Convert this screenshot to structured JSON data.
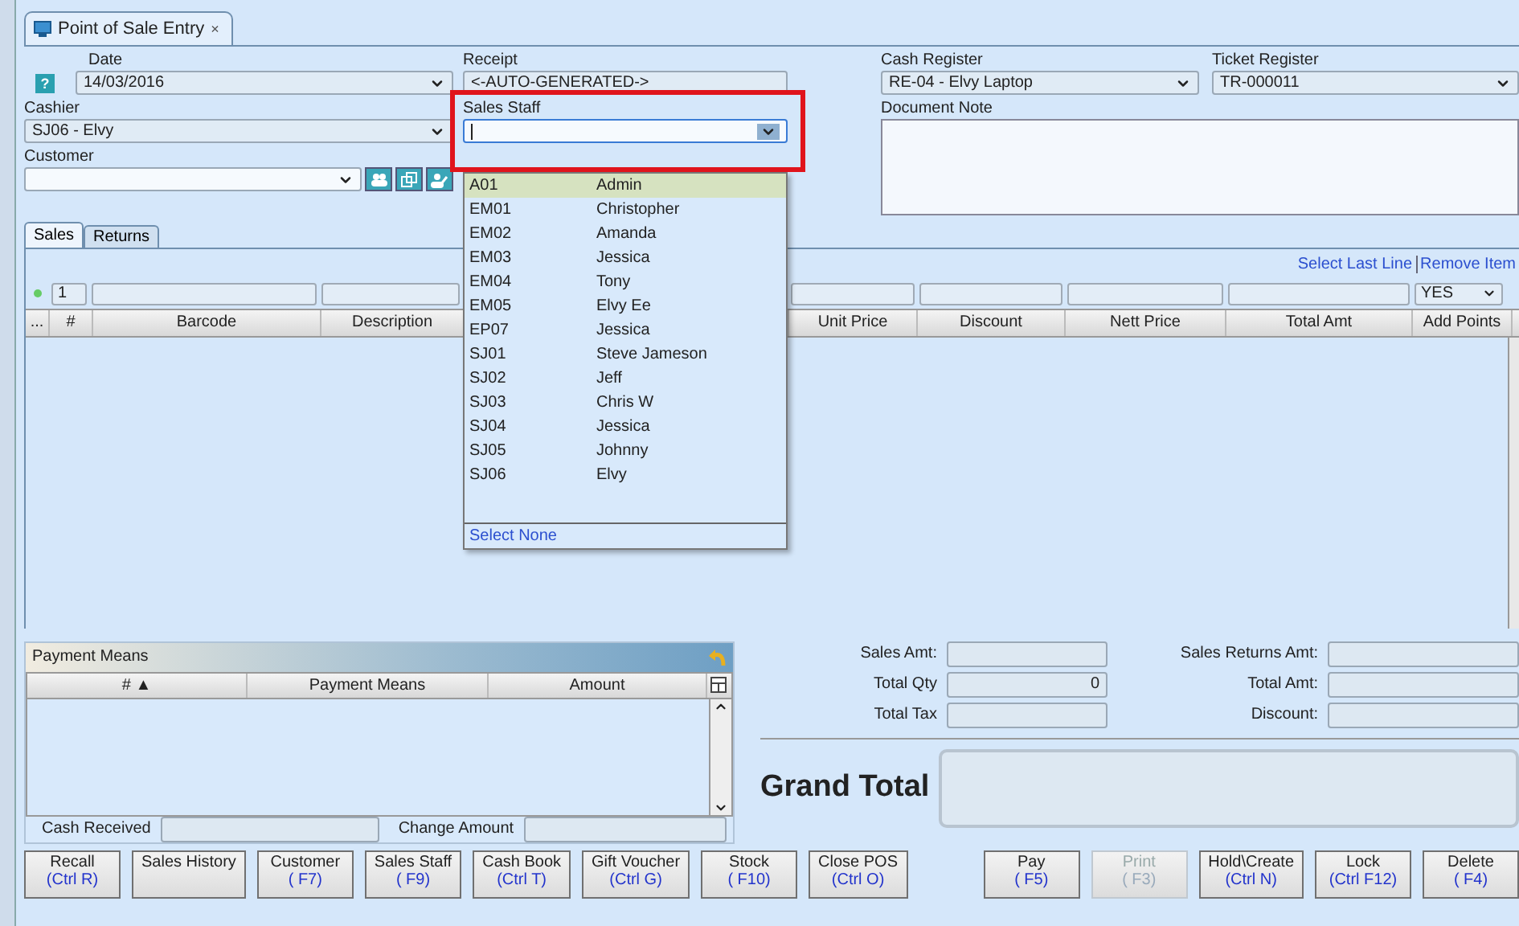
{
  "tab": {
    "label": "Point of Sale Entry",
    "close": "×"
  },
  "form": {
    "help": "?",
    "date": {
      "label": "Date",
      "value": "14/03/2016"
    },
    "receipt": {
      "label": "Receipt",
      "value": "<-AUTO-GENERATED->"
    },
    "cash_register": {
      "label": "Cash Register",
      "value": "RE-04 - Elvy Laptop"
    },
    "ticket_register": {
      "label": "Ticket Register",
      "value": "TR-000011"
    },
    "cashier": {
      "label": "Cashier",
      "value": "SJ06 - Elvy"
    },
    "sales_staff": {
      "label": "Sales Staff",
      "expanded": true
    },
    "document_note": {
      "label": "Document Note"
    },
    "customer": {
      "label": "Customer"
    }
  },
  "sales_staff_dropdown": {
    "items": [
      {
        "code": "A01",
        "name": "Admin",
        "selected": true
      },
      {
        "code": "EM01",
        "name": "Christopher",
        "selected": false
      },
      {
        "code": "EM02",
        "name": "Amanda",
        "selected": false
      },
      {
        "code": "EM03",
        "name": "Jessica",
        "selected": false
      },
      {
        "code": "EM04",
        "name": "Tony",
        "selected": false
      },
      {
        "code": "EM05",
        "name": "Elvy Ee",
        "selected": false
      },
      {
        "code": "EP07",
        "name": "Jessica",
        "selected": false
      },
      {
        "code": "SJ01",
        "name": "Steve Jameson",
        "selected": false
      },
      {
        "code": "SJ02",
        "name": "Jeff",
        "selected": false
      },
      {
        "code": "SJ03",
        "name": "Chris W",
        "selected": false
      },
      {
        "code": "SJ04",
        "name": "Jessica",
        "selected": false
      },
      {
        "code": "SJ05",
        "name": "Johnny",
        "selected": false
      },
      {
        "code": "SJ06",
        "name": "Elvy",
        "selected": false
      }
    ],
    "footer": "Select None"
  },
  "subtabs": [
    {
      "label": "Sales",
      "selected": true
    },
    {
      "label": "Returns",
      "selected": false
    }
  ],
  "grid_links": [
    "Select Last Line",
    "Remove Item"
  ],
  "filter_row": {
    "row_number": "1",
    "add_points": "YES"
  },
  "grid_columns": [
    "...",
    "#",
    "Barcode",
    "Description",
    "Unit Price",
    "Discount",
    "Nett Price",
    "Total Amt",
    "Add Points"
  ],
  "payment_means": {
    "title": "Payment Means",
    "columns": [
      "# ▲",
      "Payment Means",
      "Amount"
    ],
    "cash_received": "Cash Received",
    "change_amount": "Change Amount"
  },
  "totals": [
    {
      "label": "Sales Amt:"
    },
    {
      "label": "Sales Returns Amt:"
    },
    {
      "label": "Total Qty",
      "value": "0"
    },
    {
      "label": "Total Amt:"
    },
    {
      "label": "Total Tax"
    },
    {
      "label": "Discount:"
    }
  ],
  "grand_total": {
    "label": "Grand Total"
  },
  "buttons_left": [
    {
      "label": "Recall",
      "shortcut": "(Ctrl R)",
      "disabled": false
    },
    {
      "label": "Sales History",
      "disabled": false
    },
    {
      "label": "Customer",
      "shortcut": "( F7)",
      "disabled": false
    },
    {
      "label": "Sales Staff",
      "shortcut": "( F9)",
      "disabled": false
    },
    {
      "label": "Cash Book",
      "shortcut": "(Ctrl T)",
      "disabled": false
    },
    {
      "label": "Gift Voucher",
      "shortcut": "(Ctrl G)",
      "disabled": false
    },
    {
      "label": "Stock",
      "shortcut": "( F10)",
      "disabled": false
    },
    {
      "label": "Close POS",
      "shortcut": "(Ctrl O)",
      "disabled": false
    }
  ],
  "buttons_right": [
    {
      "label": "Pay",
      "shortcut": "( F5)",
      "disabled": false
    },
    {
      "label": "Print",
      "shortcut": "( F3)",
      "disabled": true
    },
    {
      "label": "Hold\\Create",
      "shortcut": "(Ctrl N)",
      "disabled": false
    },
    {
      "label": "Lock",
      "shortcut": "(Ctrl F12)",
      "disabled": false
    },
    {
      "label": "Delete",
      "shortcut": "( F4)",
      "disabled": false
    }
  ]
}
